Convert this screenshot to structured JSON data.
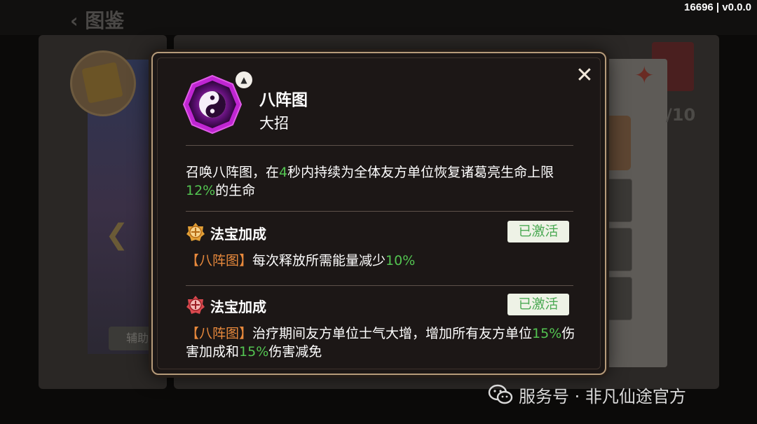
{
  "background": {
    "header_title": "图鉴",
    "side_button": "辅助",
    "ratio": "/10"
  },
  "version": "16696 | v0.0.0",
  "modal": {
    "close_label": "✕",
    "skill": {
      "name": "八阵图",
      "type": "大招",
      "description": {
        "part1": "召唤八阵图，在",
        "seconds": "4",
        "part2": "秒内持续为全体友方单位恢复诸葛亮生命上限",
        "percent": "12%",
        "part3": "的生命"
      }
    },
    "bonuses": [
      {
        "title": "法宝加成",
        "status": "已激活",
        "tag": "【八阵图】",
        "text1": "每次释放所需能量减少",
        "value1": "10%",
        "text2": "",
        "value2": "",
        "text3": ""
      },
      {
        "title": "法宝加成",
        "status": "已激活",
        "tag": "【八阵图】",
        "text1": "治疗期间友方单位士气大增，增加所有友方单位",
        "value1": "15%",
        "text2": "伤害加成和",
        "value2": "15%",
        "text3": "伤害减免"
      }
    ]
  },
  "watermark": "服务号 · 非凡仙途官方",
  "colors": {
    "accent_green": "#53c451",
    "tag_orange": "#e8893c",
    "border_gold": "#b69b7a"
  }
}
